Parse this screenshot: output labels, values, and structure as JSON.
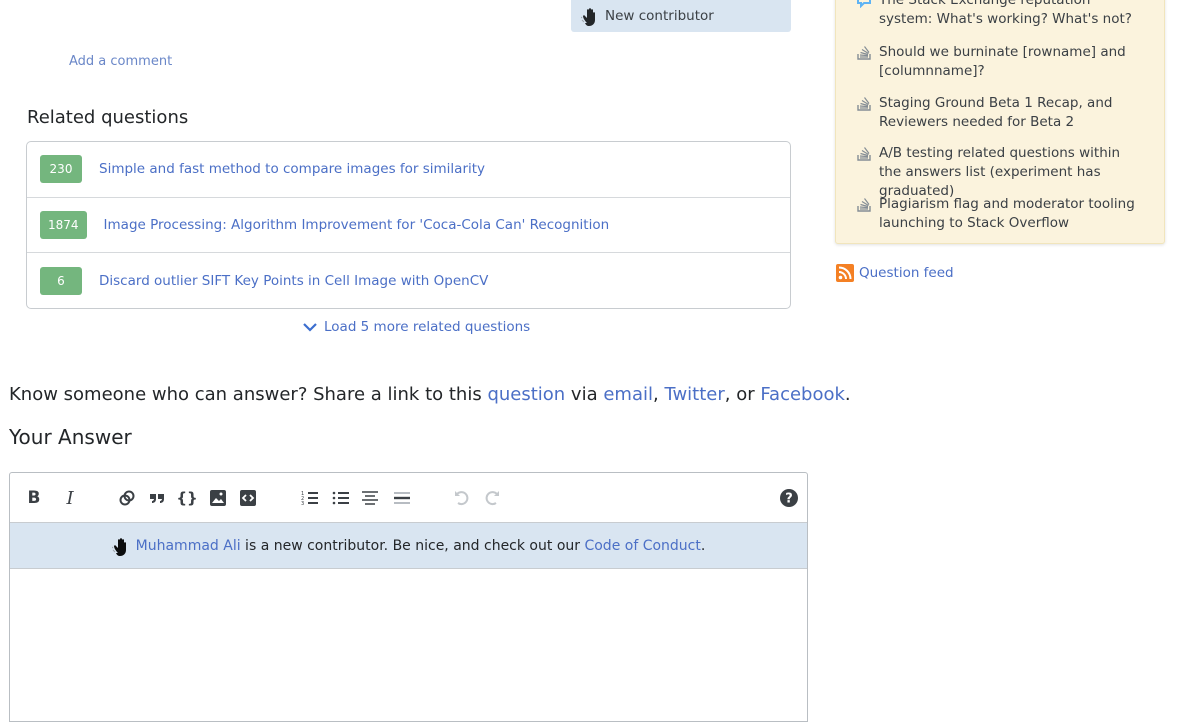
{
  "answer_owner": {
    "badge_label": "New contributor"
  },
  "comments": {
    "add_comment_label": "Add a comment"
  },
  "related": {
    "title": "Related questions",
    "items": [
      {
        "score": "230",
        "title": "Simple and fast method to compare images for similarity"
      },
      {
        "score": "1874",
        "title": "Image Processing: Algorithm Improvement for 'Coca-Cola Can' Recognition"
      },
      {
        "score": "6",
        "title": "Discard outlier SIFT Key Points in Cell Image with OpenCV"
      }
    ],
    "load_more_label": "Load 5 more related questions"
  },
  "share": {
    "prefix": "Know someone who can answer? Share a link to this ",
    "question_link": "question",
    "via": " via ",
    "email_link": "email",
    "comma": ", ",
    "twitter_link": "Twitter",
    "or": ", or ",
    "facebook_link": "Facebook",
    "suffix": "."
  },
  "answer": {
    "title": "Your Answer",
    "toolbar": {
      "bold": "B",
      "italic": "I",
      "link": "link-icon",
      "blockquote": "blockquote-icon",
      "code": "code-icon",
      "image": "image-icon",
      "snippet": "snippet-icon",
      "ordered_list": "ordered-list-icon",
      "bullet_list": "bullet-list-icon",
      "heading": "heading-icon",
      "hr": "horizontal-rule-icon",
      "undo": "undo-icon",
      "redo": "redo-icon",
      "help": "help-icon"
    },
    "notice": {
      "user_link": "Muhammad Ali",
      "text": " is a new contributor. Be nice, and check out our ",
      "coc_link": "Code of Conduct",
      "suffix": "."
    },
    "body_value": ""
  },
  "sidebar": {
    "meta_items": [
      {
        "icon": "chat-icon",
        "title": "The Stack Exchange reputation system: What's working? What's not?"
      },
      {
        "icon": "stack-icon",
        "title": "Should we burninate [rowname] and [columnname]?"
      },
      {
        "icon": "stack-icon",
        "title": "Staging Ground Beta 1 Recap, and Reviewers needed for Beta 2"
      },
      {
        "icon": "stack-icon",
        "title": "A/B testing related questions within the answers list (experiment has graduated)"
      },
      {
        "icon": "stack-icon",
        "title": "Plagiarism flag and moderator tooling launching to Stack Overflow"
      }
    ],
    "feed_label": "Question feed"
  },
  "colors": {
    "link": "#4b6fc6",
    "score_badge": "#74b67e",
    "notice_bg": "#d9e5f1",
    "meta_bg": "#fbf3dd",
    "rss": "#f48024"
  }
}
